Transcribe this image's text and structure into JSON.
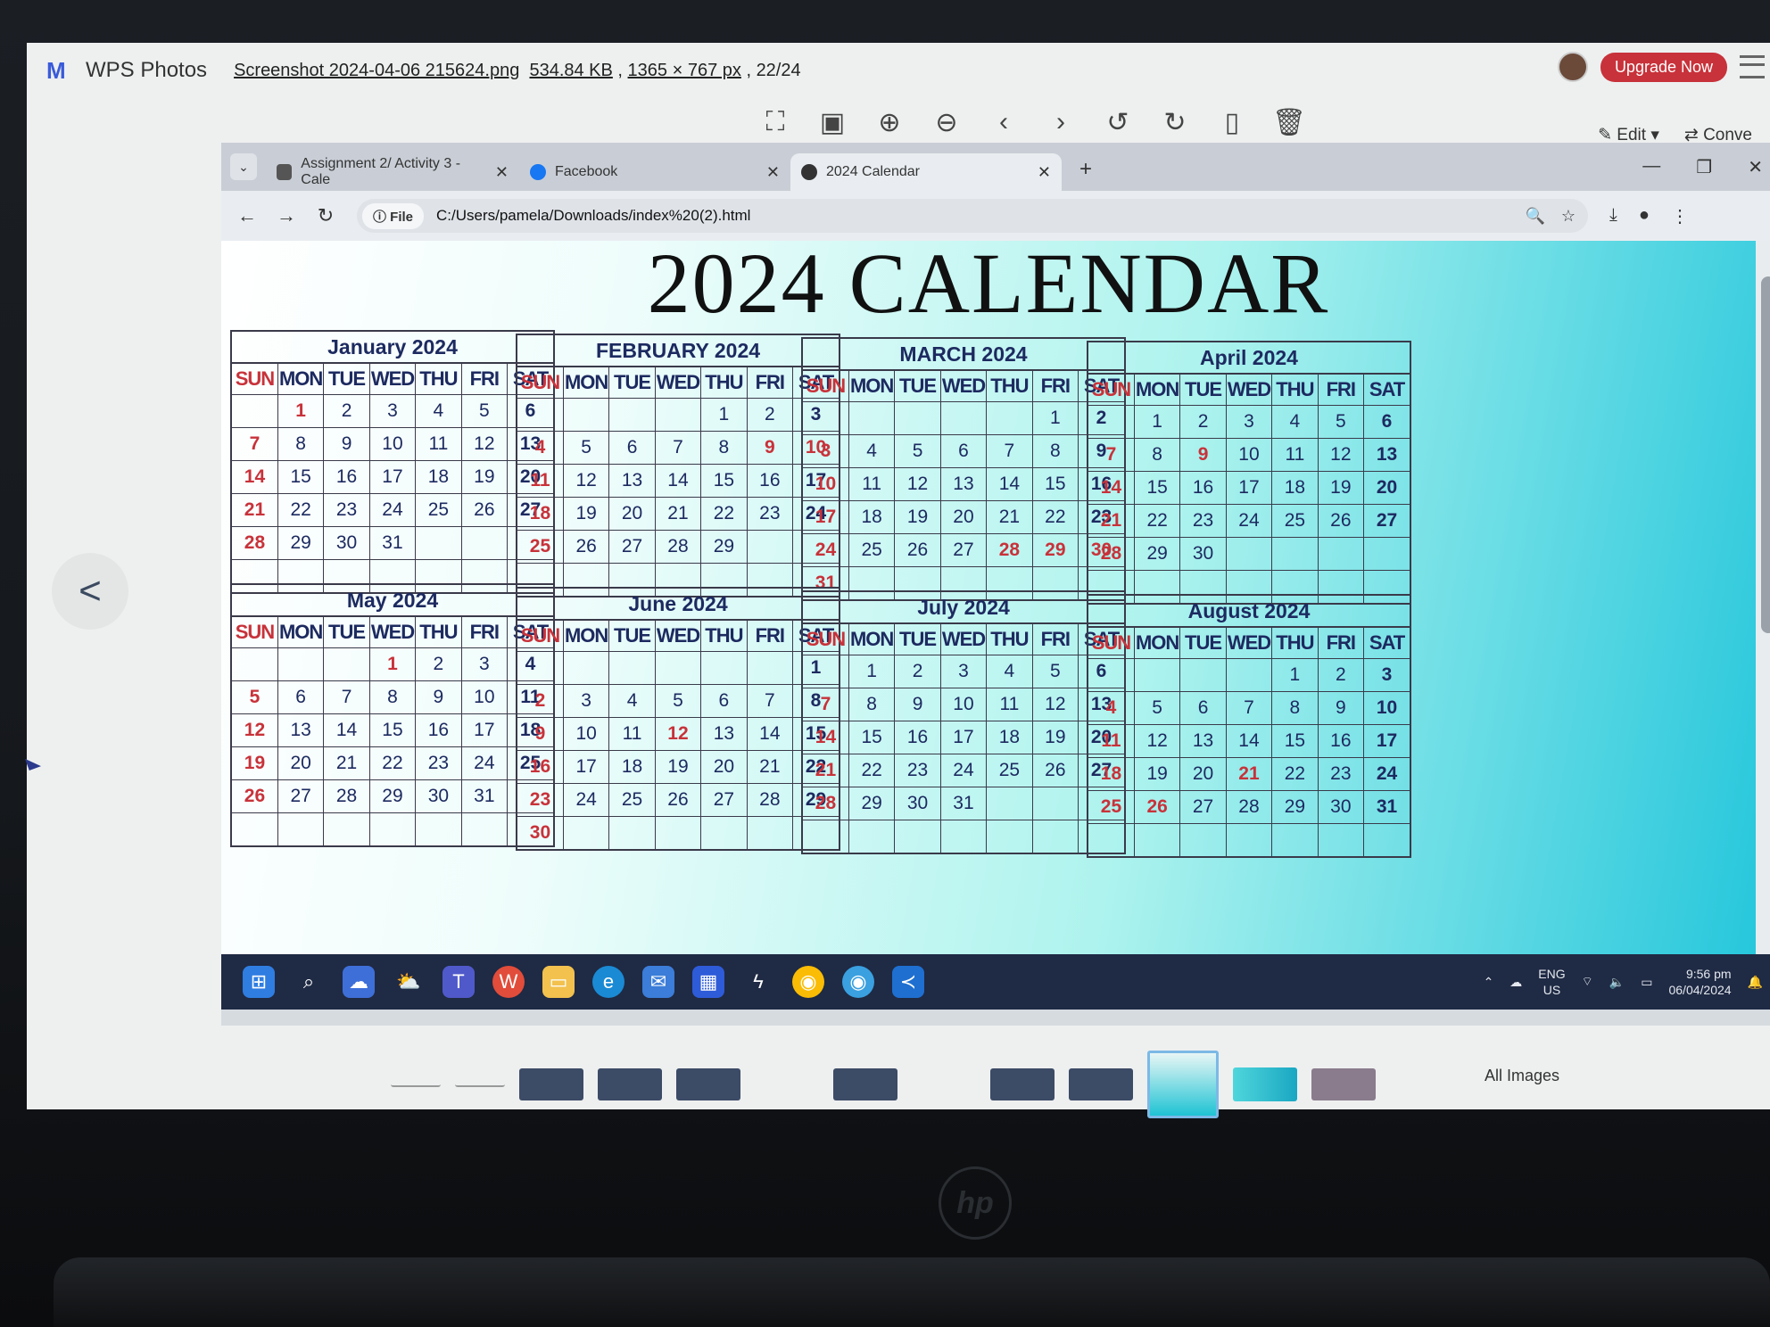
{
  "wps": {
    "app_name": "WPS Photos",
    "file_name": "Screenshot 2024-04-06 215624.png",
    "file_size": "534.84 KB",
    "dimensions": "1365 × 767 px",
    "position": "22/24",
    "upgrade_label": "Upgrade Now",
    "edit_label": "Edit",
    "convert_label": "Conve",
    "all_images_label": "All Images"
  },
  "browser": {
    "tabs": [
      {
        "label": "Assignment 2/ Activity 3 - Cale"
      },
      {
        "label": "Facebook"
      },
      {
        "label": "2024 Calendar"
      }
    ],
    "file_chip": "File",
    "url": "C:/Users/pamela/Downloads/index%20(2).html"
  },
  "page": {
    "title": "2024 CALENDAR",
    "weekdays": [
      "SUN",
      "MON",
      "TUE",
      "WED",
      "THU",
      "FRI",
      "SAT"
    ]
  },
  "months": [
    {
      "name": "January 2024",
      "start": 1,
      "days": 31,
      "holidays": [
        1
      ]
    },
    {
      "name": "FEBRUARY 2024",
      "start": 4,
      "days": 29,
      "holidays": [
        9,
        10
      ]
    },
    {
      "name": "MARCH 2024",
      "start": 5,
      "days": 31,
      "holidays": [
        28,
        29,
        30
      ]
    },
    {
      "name": "April 2024",
      "start": 1,
      "days": 30,
      "holidays": [
        9
      ]
    },
    {
      "name": "May 2024",
      "start": 3,
      "days": 31,
      "holidays": [
        1
      ]
    },
    {
      "name": "June 2024",
      "start": 6,
      "days": 30,
      "holidays": [
        12
      ]
    },
    {
      "name": "July 2024",
      "start": 1,
      "days": 31,
      "holidays": []
    },
    {
      "name": "August 2024",
      "start": 4,
      "days": 31,
      "holidays": [
        21,
        26
      ]
    }
  ],
  "taskbar": {
    "lang": "ENG",
    "region": "US",
    "time": "9:56 pm",
    "date": "06/04/2024"
  },
  "colors": {
    "accent_red": "#c8323a",
    "calendar_text": "#1d2a60",
    "taskbar": "#1f2a44"
  }
}
